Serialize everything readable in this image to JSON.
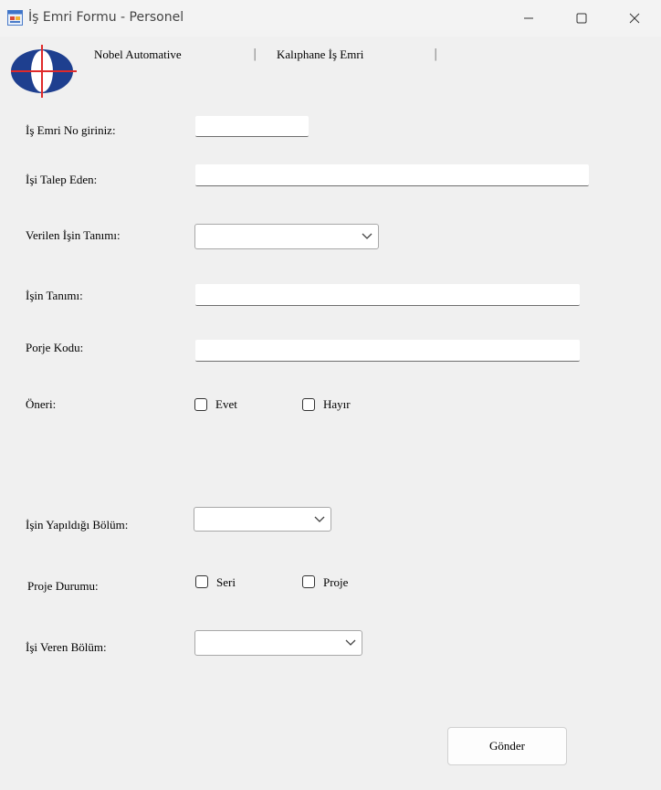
{
  "window": {
    "title": "İş Emri Formu - Personel",
    "icons": [
      "app-form-icon",
      "minimize-icon",
      "maximize-icon",
      "close-icon"
    ]
  },
  "header": {
    "logo": "company-logo-icon",
    "company_name": "Nobel Automative",
    "separator_1": "|",
    "department": "Kalıphane İş Emri",
    "separator_2": "|"
  },
  "form": {
    "work_order_no": {
      "label": "İş Emri No giriniz:",
      "value": ""
    },
    "requester": {
      "label": "İşi Talep Eden:",
      "value": ""
    },
    "given_job_description": {
      "label": "Verilen İşin Tanımı:",
      "selected": ""
    },
    "job_description": {
      "label": "İşin Tanımı:",
      "value": ""
    },
    "project_code": {
      "label": "Porje Kodu:",
      "value": ""
    },
    "suggestion": {
      "label": "Öneri:",
      "options": [
        {
          "label": "Evet",
          "checked": false
        },
        {
          "label": "Hayır",
          "checked": false
        }
      ]
    },
    "performed_department": {
      "label": "İşin Yapıldığı Bölüm:",
      "selected": ""
    },
    "project_status": {
      "label": "Proje Durumu:",
      "options": [
        {
          "label": "Seri",
          "checked": false
        },
        {
          "label": "Proje",
          "checked": false
        }
      ]
    },
    "issuing_department": {
      "label": "İşi Veren Bölüm:",
      "selected": ""
    },
    "submit_label": "Gönder"
  }
}
